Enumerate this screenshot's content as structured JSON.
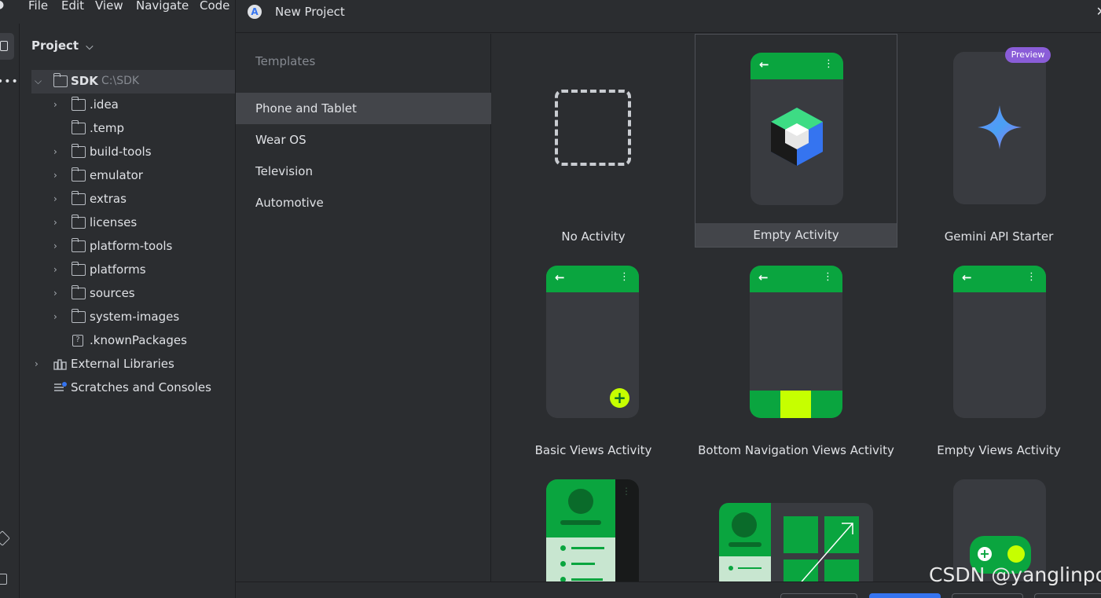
{
  "menubar": {
    "items": [
      "File",
      "Edit",
      "View",
      "Navigate",
      "Code"
    ]
  },
  "project_panel": {
    "title": "Project",
    "root": {
      "name": "SDK",
      "path": "C:\\SDK"
    },
    "items": [
      {
        "label": ".idea",
        "expandable": true
      },
      {
        "label": ".temp",
        "expandable": false
      },
      {
        "label": "build-tools",
        "expandable": true
      },
      {
        "label": "emulator",
        "expandable": true
      },
      {
        "label": "extras",
        "expandable": true
      },
      {
        "label": "licenses",
        "expandable": true
      },
      {
        "label": "platform-tools",
        "expandable": true
      },
      {
        "label": "platforms",
        "expandable": true
      },
      {
        "label": "sources",
        "expandable": true
      },
      {
        "label": "system-images",
        "expandable": true
      },
      {
        "label": ".knownPackages",
        "expandable": false
      }
    ],
    "external_libraries": "External Libraries",
    "scratches": "Scratches and Consoles"
  },
  "dialog": {
    "title": "New Project",
    "templates_label": "Templates",
    "categories": [
      "Phone and Tablet",
      "Wear OS",
      "Television",
      "Automotive"
    ],
    "selected_category": "Phone and Tablet",
    "templates": [
      "No Activity",
      "Empty Activity",
      "Gemini API Starter",
      "Basic Views Activity",
      "Bottom Navigation Views Activity",
      "Empty Views Activity"
    ],
    "selected_template": "Empty Activity",
    "preview_badge": "Preview"
  },
  "watermark": "CSDN @yanglinpo",
  "colors": {
    "accent_green": "#0aa53f",
    "lime": "#c6ff00",
    "preview": "#8a5dd8",
    "selection": "#43454a",
    "primary_button": "#3574f0"
  }
}
